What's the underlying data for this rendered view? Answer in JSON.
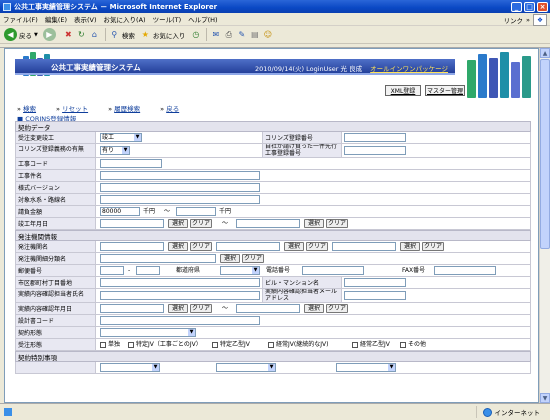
{
  "window": {
    "title": "公共工事実績管理システム － Microsoft Internet Explorer"
  },
  "menu": {
    "items": [
      "ファイル(F)",
      "編集(E)",
      "表示(V)",
      "お気に入り(A)",
      "ツール(T)",
      "ヘルプ(H)"
    ],
    "link_label": "リンク"
  },
  "toolbar": {
    "back": "戻る",
    "search": "検索",
    "favorites": "お気に入り"
  },
  "status": {
    "zone": "インターネット"
  },
  "header": {
    "system_name": "公共工事実績管理システム",
    "login_info": "2010/09/14(火) LoginUser 光 良成",
    "all_in_one_link": "オールインワンパッケージ",
    "xml_button": "XML登録",
    "master_button": "マスター管理"
  },
  "nav": {
    "search": "検索",
    "reset": "リセット",
    "history": "履歴検索",
    "back": "戻る"
  },
  "section_link": "CORINS登録情報",
  "contract": {
    "heading": "契約データ",
    "change_label": "受注変更竣工",
    "change_value": "竣工",
    "corins_label": "コリンズ登録番号",
    "corins_required_label": "コリンズ登録義務の有無",
    "corins_required_value": "有り",
    "company_label": "自社が請け負った一件先行工事登録番号",
    "work_code": "工事コード",
    "work_name": "工事件名",
    "version": "様式バージョン",
    "water_system": "対象水系・路線名",
    "contract_amount": "請負金額",
    "amount_value": "80000",
    "yen_unit": "千円",
    "tilde": "～",
    "completion_date": "竣工年月日",
    "select": "選択",
    "clear": "クリア"
  },
  "orderer": {
    "heading": "発注機関情報",
    "org_name": "発注機関名",
    "org_detail": "発注機関細分類名",
    "postal": "郵便番号",
    "dash": "-",
    "prefecture": "都道府県",
    "phone": "電話番号",
    "fax": "FAX番号",
    "address": "市区郡町村丁目番地",
    "building": "ビル・マンション名",
    "confirm_person": "実績内容確認担当者氏名",
    "confirm_mail": "実績内容確認担当者メールアドレス",
    "confirm_date": "実績内容確認年月日",
    "design_code": "設計書コード",
    "contract_form": "契約形態",
    "order_form": "受注形態",
    "order_options": [
      "単独",
      "特定JV（工事ごとのJV）",
      "特定乙型JV",
      "経常JV(継続的なJV)",
      "経常乙型JV",
      "その他"
    ],
    "special_heading": "契約特別事項"
  }
}
